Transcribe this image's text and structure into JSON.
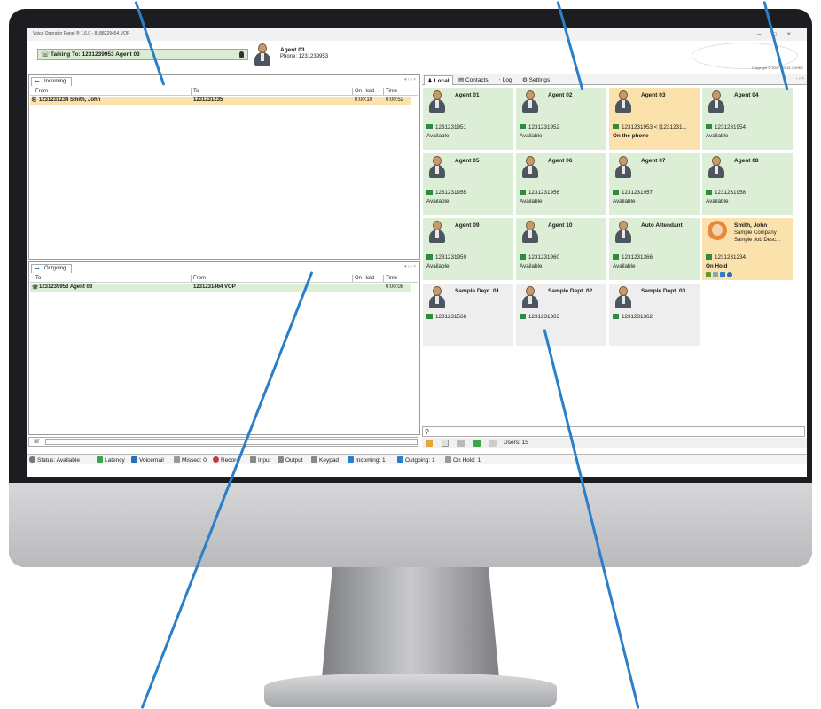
{
  "app": {
    "window_title": "Voice Operator Panel ® 1.6.0 - 8188229454 VOP",
    "talking_to": "Talking To: 1231239953 Agent 03",
    "agent_name": "Agent 03",
    "agent_phone": "Phone: 1231239953",
    "copyright": "Copyright © 2007 - 2016 JOHKE"
  },
  "incoming": {
    "tab_label": "Incoming",
    "columns": [
      "From",
      "To",
      "On Hold",
      "Time"
    ],
    "rows": [
      {
        "from": "1231231234 Smith, John",
        "to": "1231231235",
        "on_hold": "0:00:10",
        "time": "0:00:52"
      }
    ]
  },
  "outgoing": {
    "tab_label": "Outgoing",
    "columns": [
      "To",
      "From",
      "On Hold",
      "Time"
    ],
    "rows": [
      {
        "to": "1231239953 Agent 03",
        "from": "1231231464 VOP",
        "on_hold": "",
        "time": "0:00:08"
      }
    ]
  },
  "right_tabs": [
    "Local",
    "Contacts",
    "Log",
    "Settings"
  ],
  "cards": [
    {
      "name": "Agent 01",
      "phone": "1231231951",
      "status": "Available",
      "bg": "#dcefd6"
    },
    {
      "name": "Agent 02",
      "phone": "1231231952",
      "status": "Available",
      "bg": "#dcefd6"
    },
    {
      "name": "Agent 03",
      "phone": "1231231953 < [1231231...",
      "status": "On the phone",
      "bg": "#fbe1ac"
    },
    {
      "name": "Agent 04",
      "phone": "1231231954",
      "status": "Available",
      "bg": "#dcefd6"
    },
    {
      "name": "Agent 05",
      "phone": "1231231955",
      "status": "Available",
      "bg": "#dcefd6"
    },
    {
      "name": "Agent 06",
      "phone": "1231231956",
      "status": "Available",
      "bg": "#dcefd6"
    },
    {
      "name": "Agent 07",
      "phone": "1231231957",
      "status": "Available",
      "bg": "#dcefd6"
    },
    {
      "name": "Agent 08",
      "phone": "1231231958",
      "status": "Available",
      "bg": "#dcefd6"
    },
    {
      "name": "Agent 09",
      "phone": "1231231959",
      "status": "Available",
      "bg": "#dcefd6"
    },
    {
      "name": "Agent 10",
      "phone": "1231231960",
      "status": "Available",
      "bg": "#dcefd6"
    },
    {
      "name": "Auto Attendant",
      "phone": "1231231366",
      "status": "Available",
      "bg": "#dcefd6"
    },
    {
      "name": "Smith, John",
      "company": "Sample Company",
      "job": "Sample Job Desc...",
      "phone": "1231231234",
      "status": "On Hold",
      "bg": "#fbe1ac"
    },
    {
      "name": "Sample Dept. 01",
      "phone": "1231231568",
      "status": "",
      "bg": "#eeeeee"
    },
    {
      "name": "Sample Dept. 02",
      "phone": "1231231363",
      "status": "",
      "bg": "#eeeeee"
    },
    {
      "name": "Sample Dept. 03",
      "phone": "1231231362",
      "status": "",
      "bg": "#eeeeee"
    }
  ],
  "users_count": "Users: 15",
  "statusbar": {
    "status": "Status: Available",
    "latency": "Latency",
    "voicemail": "Voicemail",
    "missed": "Missed: 0",
    "record": "Record",
    "input": "Input",
    "output": "Output",
    "keypad": "Keypad",
    "incoming": "Incoming: 1",
    "outgoing": "Outgoing: 1",
    "on_hold": "On Hold: 1"
  },
  "colors": {
    "available": "#dcefd6",
    "busy": "#fbe1ac",
    "dept": "#eeeeee",
    "callout": "#2c7fc6"
  }
}
